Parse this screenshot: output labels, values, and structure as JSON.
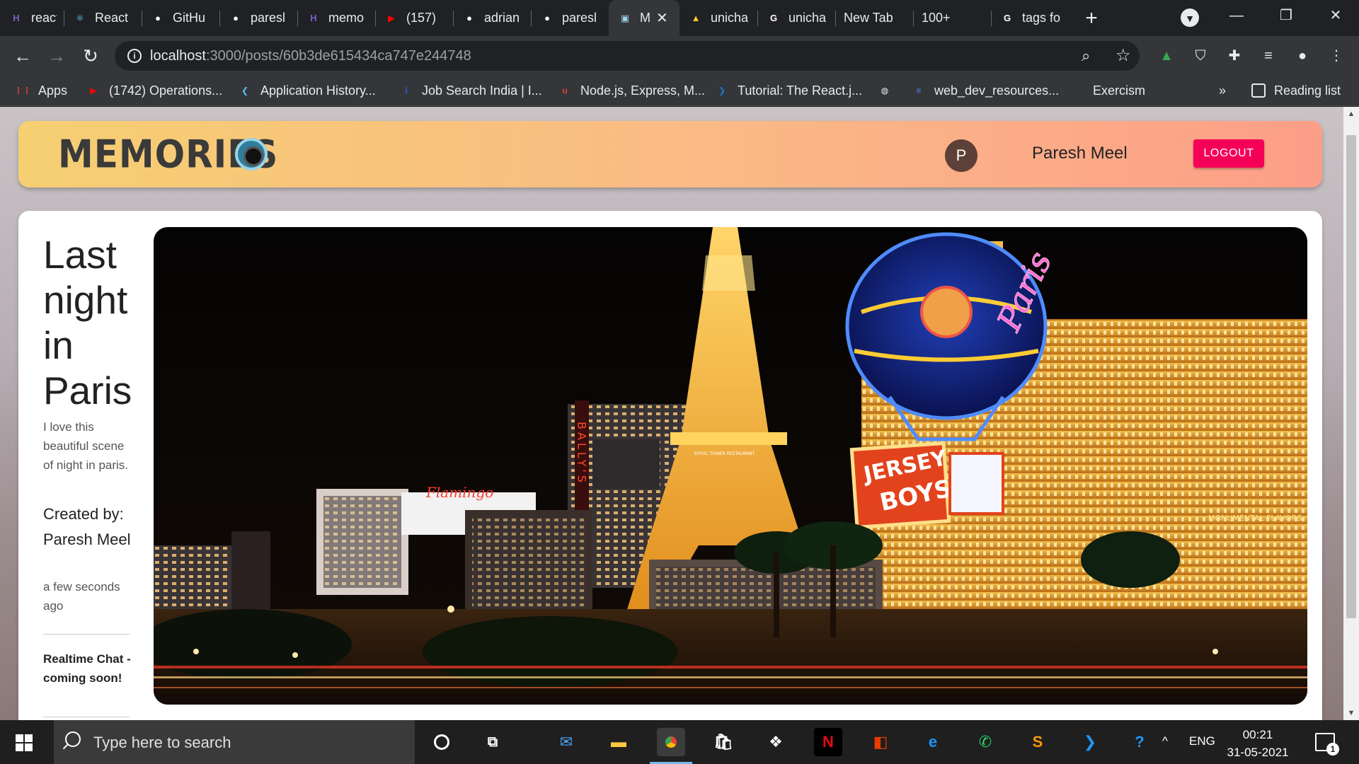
{
  "browser": {
    "tabs": [
      {
        "title": "react-",
        "icon": "hashnode-icon",
        "color": "#7b5fd1",
        "glyph": "H"
      },
      {
        "title": "React",
        "icon": "react-icon",
        "color": "#61dafb",
        "glyph": "⚛"
      },
      {
        "title": "GitHu",
        "icon": "github-icon",
        "color": "#ffffff",
        "glyph": "●"
      },
      {
        "title": "paresl",
        "icon": "github-icon",
        "color": "#ffffff",
        "glyph": "●"
      },
      {
        "title": "memo",
        "icon": "hashnode-icon",
        "color": "#7b5fd1",
        "glyph": "H"
      },
      {
        "title": "(157)",
        "icon": "youtube-icon",
        "color": "#ff0000",
        "glyph": "▶"
      },
      {
        "title": "adrian",
        "icon": "github-icon",
        "color": "#ffffff",
        "glyph": "●"
      },
      {
        "title": "paresl",
        "icon": "github-icon",
        "color": "#ffffff",
        "glyph": "●"
      },
      {
        "title": "M",
        "icon": "memories-icon",
        "color": "#9ad3e6",
        "glyph": "▣",
        "active": true
      },
      {
        "title": "unicha",
        "icon": "firebase-icon",
        "color": "#ffca28",
        "glyph": "▲"
      },
      {
        "title": "unicha",
        "icon": "google-icon",
        "color": "#ffffff",
        "glyph": "G"
      },
      {
        "title": "New Tab",
        "icon": "",
        "color": "",
        "glyph": ""
      },
      {
        "title": "100+",
        "icon": "",
        "color": "",
        "glyph": ""
      },
      {
        "title": "tags fo",
        "icon": "google-icon",
        "color": "#ffffff",
        "glyph": "G"
      }
    ],
    "new_tab": "+",
    "url_host": "localhost",
    "url_path": ":3000/posts/60b3de615434ca747e244748",
    "bookmarks": [
      {
        "label": "Apps",
        "icon": "apps-grid-icon",
        "color": "#ea4335",
        "glyph": "⋮⋮"
      },
      {
        "label": "(1742) Operations...",
        "icon": "youtube-icon",
        "color": "#ff0000",
        "glyph": "▶"
      },
      {
        "label": "Application History...",
        "icon": "bookmark-app-icon",
        "color": "#4fc3f7",
        "glyph": "❮"
      },
      {
        "label": "Job Search India | I...",
        "icon": "indeed-icon",
        "color": "#2164f3",
        "glyph": "i"
      },
      {
        "label": "Node.js, Express, M...",
        "icon": "udemy-icon",
        "color": "#e53935",
        "glyph": "u"
      },
      {
        "label": "Tutorial: The React.j...",
        "icon": "react-bookmark-icon",
        "color": "#1976d2",
        "glyph": "❯"
      },
      {
        "label": "",
        "icon": "globe-icon",
        "color": "#e8eaed",
        "glyph": "◍"
      },
      {
        "label": "web_dev_resources...",
        "icon": "docs-icon",
        "color": "#4285f4",
        "glyph": "≡"
      },
      {
        "label": "Exercism",
        "icon": "exercism-icon",
        "color": "#35363a",
        "glyph": "{·}"
      }
    ],
    "more_bookmarks": "»",
    "reading_list": "Reading list"
  },
  "app": {
    "brand": "MEMORIES",
    "user_initial": "P",
    "user_name": "Paresh Meel",
    "logout_label": "LOGOUT"
  },
  "post": {
    "title": "Last night in Paris",
    "message": "I love this beautiful scene of night in paris.",
    "created_by": "Created by: Paresh Meel",
    "time_ago": "a few seconds ago",
    "chat_note": "Realtime Chat - coming soon!"
  },
  "photo": {
    "signs": {
      "ballys": "BALLY'S",
      "jersey_top": "JERSEY",
      "jersey_bottom": "BOYS",
      "paris": "Paris",
      "flamingo": "Flamingo",
      "tower_restaurant": "EIFFEL TOWER RESTAURANT",
      "monumental": "MONUMENTAL FLAVORS"
    }
  },
  "taskbar": {
    "search_placeholder": "Type here to search",
    "language": "ENG",
    "time": "00:21",
    "date": "31-05-2021",
    "notifications": "1"
  }
}
